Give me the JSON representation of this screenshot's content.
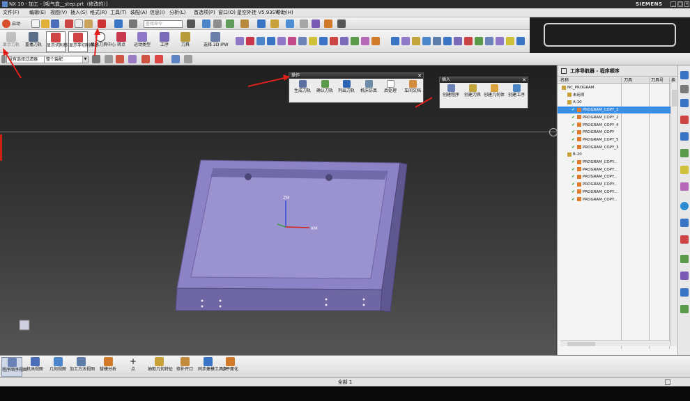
{
  "window": {
    "title": "NX 10 - 加工 - [吸气盒__step.prt（修改的）]",
    "brand": "SIEMENS"
  },
  "menu": [
    "文件(F)",
    "编辑(E)",
    "视图(V)",
    "插入(S)",
    "格式(R)",
    "工具(T)",
    "装配(A)",
    "信息(I)",
    "分析(L)",
    "首选项(P)",
    "窗口(O)",
    "星空外挂 V5.93SV",
    "帮助(H)"
  ],
  "toolbar1": {
    "start_label": "启动·",
    "search_placeholder": "查找命令"
  },
  "toolbar2": {
    "buttons": [
      "显示刀轨",
      "重播刀轨",
      "显示切削移动",
      "显示非切削移动",
      "显示刀具中心",
      "转点",
      "运动类型",
      "工序",
      "刀具"
    ],
    "select_label": "选择 2D IPW"
  },
  "toolbar3": {
    "filter": "没有选择过滤器",
    "scope": "整个装配"
  },
  "panel_ops": {
    "title": "操作",
    "buttons": [
      "生成刀轨",
      "确认刀轨",
      "列出刀轨",
      "机床仿真",
      "后处理",
      "车间文档"
    ]
  },
  "panel_insert": {
    "title": "插入",
    "buttons": [
      "创建程序",
      "创建刀具",
      "创建几何体",
      "创建工序"
    ]
  },
  "navigator": {
    "title": "工序导航器 - 程序顺序",
    "columns": [
      "名称",
      "刀具",
      "刀具号",
      "换"
    ],
    "rows": [
      {
        "indent": 0,
        "text": "NC_PROGRAM",
        "check": false,
        "sel": false
      },
      {
        "indent": 1,
        "text": "未用项",
        "check": false,
        "sel": false
      },
      {
        "indent": 1,
        "text": "A-10",
        "check": false,
        "sel": false
      },
      {
        "indent": 2,
        "text": "PROGRAM_COPY_1",
        "check": true,
        "sel": true
      },
      {
        "indent": 2,
        "text": "PROGRAM_COPY_2",
        "check": true,
        "sel": false
      },
      {
        "indent": 2,
        "text": "PROGRAM_COPY_4",
        "check": true,
        "sel": false
      },
      {
        "indent": 2,
        "text": "PROGRAM_COPY",
        "check": true,
        "sel": false
      },
      {
        "indent": 2,
        "text": "PROGRAM_COPY_5",
        "check": true,
        "sel": false
      },
      {
        "indent": 2,
        "text": "PROGRAM_COPY_3",
        "check": true,
        "sel": false
      },
      {
        "indent": 1,
        "text": "B-20",
        "check": false,
        "sel": false
      },
      {
        "indent": 2,
        "text": "PROGRAM_COPY...",
        "check": true,
        "sel": false
      },
      {
        "indent": 2,
        "text": "PROGRAM_COPY...",
        "check": true,
        "sel": false
      },
      {
        "indent": 2,
        "text": "PROGRAM_COPY...",
        "check": true,
        "sel": false
      },
      {
        "indent": 2,
        "text": "PROGRAM_COPY...",
        "check": true,
        "sel": false
      },
      {
        "indent": 2,
        "text": "PROGRAM_COPY...",
        "check": true,
        "sel": false
      },
      {
        "indent": 2,
        "text": "PROGRAM_COPY...",
        "check": true,
        "sel": false
      }
    ]
  },
  "bottom": {
    "buttons": [
      "程序顺序视图",
      "机床视图",
      "几何视图",
      "加工方法视图",
      "拔模分析",
      "点",
      "抽取几何特征",
      "修补开口",
      "同步建模工具条",
      "小平面化"
    ]
  },
  "status": {
    "text": "全部 1"
  },
  "axes": {
    "z": "ZM",
    "x": "XM"
  },
  "colors": {
    "part": "#8c82c6",
    "part_dark": "#5f5890",
    "selection": "#3a8ee6",
    "arrow": "#e0201a"
  }
}
